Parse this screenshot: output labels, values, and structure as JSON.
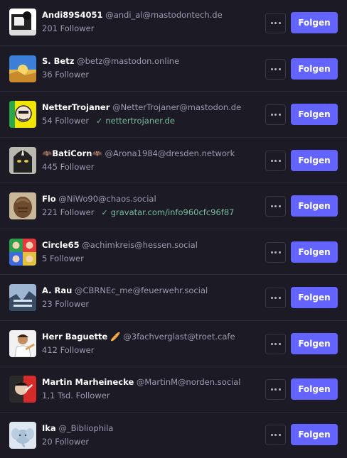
{
  "follow_label": "Folgen",
  "accounts": [
    {
      "name": "Andi89S4051",
      "handle": "@andi_al@mastodontech.de",
      "followers": "201 Follower",
      "verified": ""
    },
    {
      "name": "S. Betz",
      "handle": "@betz@mastodon.online",
      "followers": "36 Follower",
      "verified": ""
    },
    {
      "name": "NetterTrojaner",
      "handle": "@NetterTrojaner@mastodon.de",
      "followers": "54 Follower",
      "verified": "nettertrojaner.de"
    },
    {
      "name": "🦇BatiCorn🦇",
      "handle": "@Arona1984@dresden.network",
      "followers": "445 Follower",
      "verified": ""
    },
    {
      "name": "Flo",
      "handle": "@NiWo90@chaos.social",
      "followers": "221 Follower",
      "verified": "gravatar.com/info960cfc96f87"
    },
    {
      "name": "Circle65",
      "handle": "@achimkreis@hessen.social",
      "followers": "5 Follower",
      "verified": ""
    },
    {
      "name": "A. Rau",
      "handle": "@CBRNEc_me@feuerwehr.social",
      "followers": "23 Follower",
      "verified": ""
    },
    {
      "name": "Herr Baguette 🥖",
      "handle": "@3fachverglast@troet.cafe",
      "followers": "412 Follower",
      "verified": ""
    },
    {
      "name": "Martin Marheinecke",
      "handle": "@MartinM@norden.social",
      "followers": "1,1 Tsd. Follower",
      "verified": ""
    },
    {
      "name": "Ika",
      "handle": "@_Bibliophila",
      "followers": "20 Follower",
      "verified": ""
    }
  ]
}
